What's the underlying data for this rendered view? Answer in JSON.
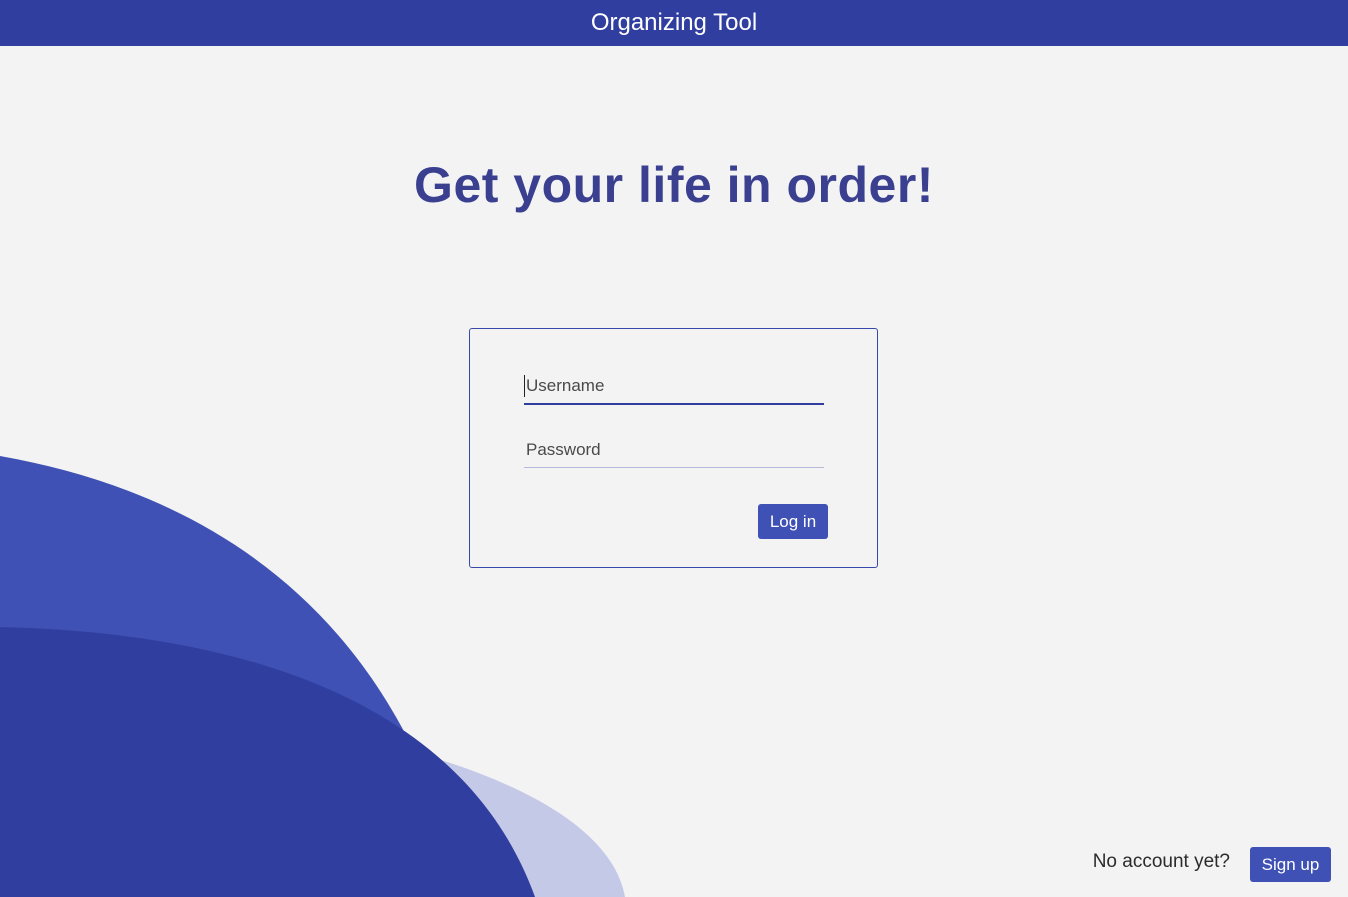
{
  "window": {
    "title": "Organizing Tool"
  },
  "main": {
    "headline": "Get your life in order!"
  },
  "login_form": {
    "username_placeholder": "Username",
    "username_value": "",
    "password_placeholder": "Password",
    "password_value": "",
    "login_label": "Log in"
  },
  "footer": {
    "prompt": "No account yet?",
    "signup_label": "Sign up"
  },
  "colors": {
    "primary": "#303f9f",
    "accent": "#3f51b5",
    "headline": "#3a3f8f",
    "background": "#f3f3f3",
    "wave_light": "#c5c9e8"
  }
}
